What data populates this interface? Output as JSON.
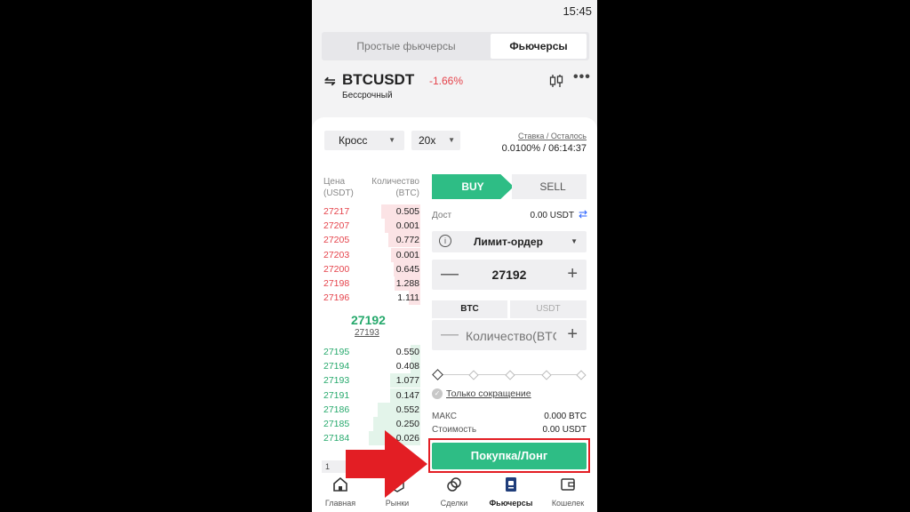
{
  "status_bar": {
    "time": "15:45"
  },
  "mode_tabs": [
    {
      "label": "Простые фьючерсы",
      "active": false
    },
    {
      "label": "Фьючерсы",
      "active": true
    }
  ],
  "instrument": {
    "symbol": "BTCUSDT",
    "change": "-1.66%",
    "subtitle": "Бессрочный"
  },
  "controls": {
    "margin_mode": "Кросс",
    "leverage": "20x",
    "funding_label": "Ставка / Осталось",
    "funding_value": "0.0100% / 06:14:37"
  },
  "orderbook": {
    "price_header": "Цена\n(USDT)",
    "qty_header": "Количество\n(BTC)",
    "asks": [
      {
        "price": "27217",
        "qty": "0.505",
        "depth": 0.4
      },
      {
        "price": "27207",
        "qty": "0.001",
        "depth": 0.36
      },
      {
        "price": "27205",
        "qty": "0.772",
        "depth": 0.32
      },
      {
        "price": "27203",
        "qty": "0.001",
        "depth": 0.3
      },
      {
        "price": "27200",
        "qty": "0.645",
        "depth": 0.27
      },
      {
        "price": "27198",
        "qty": "1.288",
        "depth": 0.26
      },
      {
        "price": "27196",
        "qty": "1.111",
        "depth": 0.12
      }
    ],
    "last_price": "27192",
    "mark_price": "27193",
    "bids": [
      {
        "price": "27195",
        "qty": "0.550",
        "depth": 0.1
      },
      {
        "price": "27194",
        "qty": "0.408",
        "depth": 0.1
      },
      {
        "price": "27193",
        "qty": "1.077",
        "depth": 0.31
      },
      {
        "price": "27191",
        "qty": "0.147",
        "depth": 0.31
      },
      {
        "price": "27186",
        "qty": "0.552",
        "depth": 0.43
      },
      {
        "price": "27185",
        "qty": "0.250",
        "depth": 0.48
      },
      {
        "price": "27184",
        "qty": "0.026",
        "depth": 0.52
      }
    ],
    "depth_step": "1"
  },
  "order_form": {
    "buy_label": "BUY",
    "sell_label": "SELL",
    "available_label": "Дост",
    "available_value": "0.00 USDT",
    "order_type": "Лимит-ордер",
    "price": "27192",
    "unit_tabs": [
      "BTC",
      "USDT"
    ],
    "qty_placeholder": "Количество(BTC)",
    "slider_value": 0,
    "reduce_only_label": "Только сокращение",
    "max_label": "МАКС",
    "max_value": "0.000 BTC",
    "cost_label": "Стоимость",
    "cost_value": "0.00 USDT",
    "submit_label": "Покупка/Лонг"
  },
  "bottom_nav": [
    {
      "label": "Главная",
      "icon": "home-icon",
      "active": false
    },
    {
      "label": "Рынки",
      "icon": "markets-icon",
      "active": false
    },
    {
      "label": "Сделки",
      "icon": "trades-icon",
      "active": false
    },
    {
      "label": "Фьючерсы",
      "icon": "futures-icon",
      "active": true
    },
    {
      "label": "Кошелек",
      "icon": "wallet-icon",
      "active": false
    }
  ],
  "colors": {
    "buy_green": "#2ebd85",
    "sell_red": "#e5424a",
    "annotation_red": "#e31e24"
  }
}
